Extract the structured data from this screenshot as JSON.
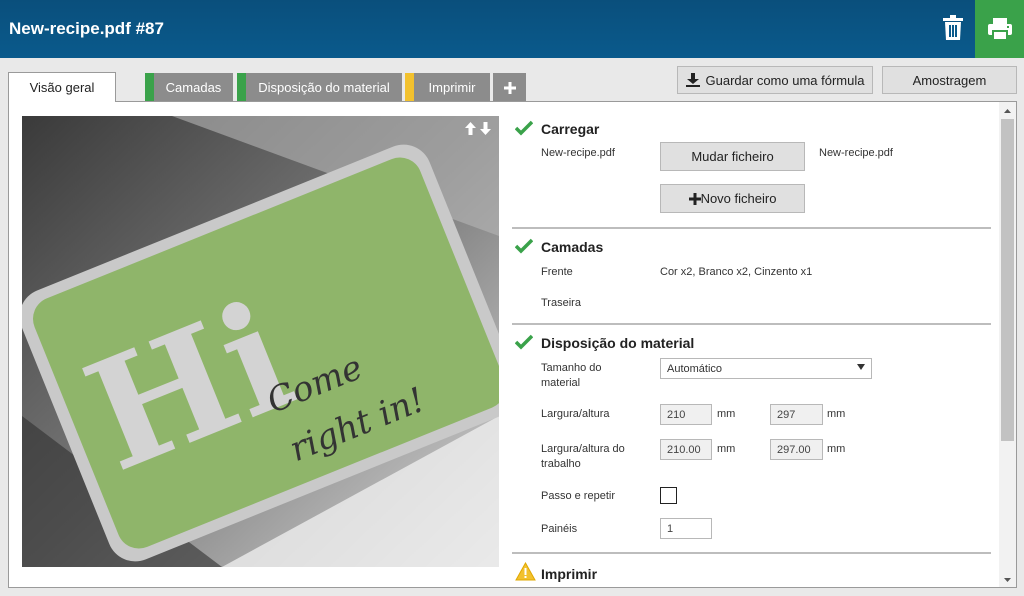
{
  "header": {
    "title": "New-recipe.pdf #87"
  },
  "tabs": [
    {
      "label": "Visão geral",
      "active": true
    },
    {
      "label": "Camadas",
      "status_color": "#3aa24a"
    },
    {
      "label": "Disposição do material",
      "status_color": "#3aa24a"
    },
    {
      "label": "Imprimir",
      "status_color": "#f2c12e"
    }
  ],
  "toolbar": {
    "save_formula_label": "Guardar como uma fórmula",
    "sampling_label": "Amostragem"
  },
  "preview": {
    "headline": "Hi",
    "tagline_1": "Come",
    "tagline_2": "right in!"
  },
  "load": {
    "title": "Carregar",
    "file_label": "New-recipe.pdf",
    "change_button": "Mudar ficheiro",
    "file_value": "New-recipe.pdf",
    "new_file_button": "Novo ficheiro"
  },
  "layers": {
    "title": "Camadas",
    "front_label": "Frente",
    "front_value": "Cor x2, Branco x2, Cinzento x1",
    "back_label": "Traseira"
  },
  "material": {
    "title": "Disposição do material",
    "size_label": "Tamanho do material",
    "size_value": "Automático",
    "wh_label": "Largura/altura",
    "width_value": "210",
    "height_value": "297",
    "unit": "mm",
    "job_wh_label": "Largura/altura do trabalho",
    "job_width_value": "210.00",
    "job_height_value": "297.00",
    "step_repeat_label": "Passo e repetir",
    "panels_label": "Painéis",
    "panels_value": "1"
  },
  "print": {
    "title": "Imprimir"
  },
  "colors": {
    "header_bg": "#0a5a8c",
    "print_accent": "#3aa24a",
    "check_green": "#3aa24a",
    "warning_yellow": "#f2c12e"
  }
}
